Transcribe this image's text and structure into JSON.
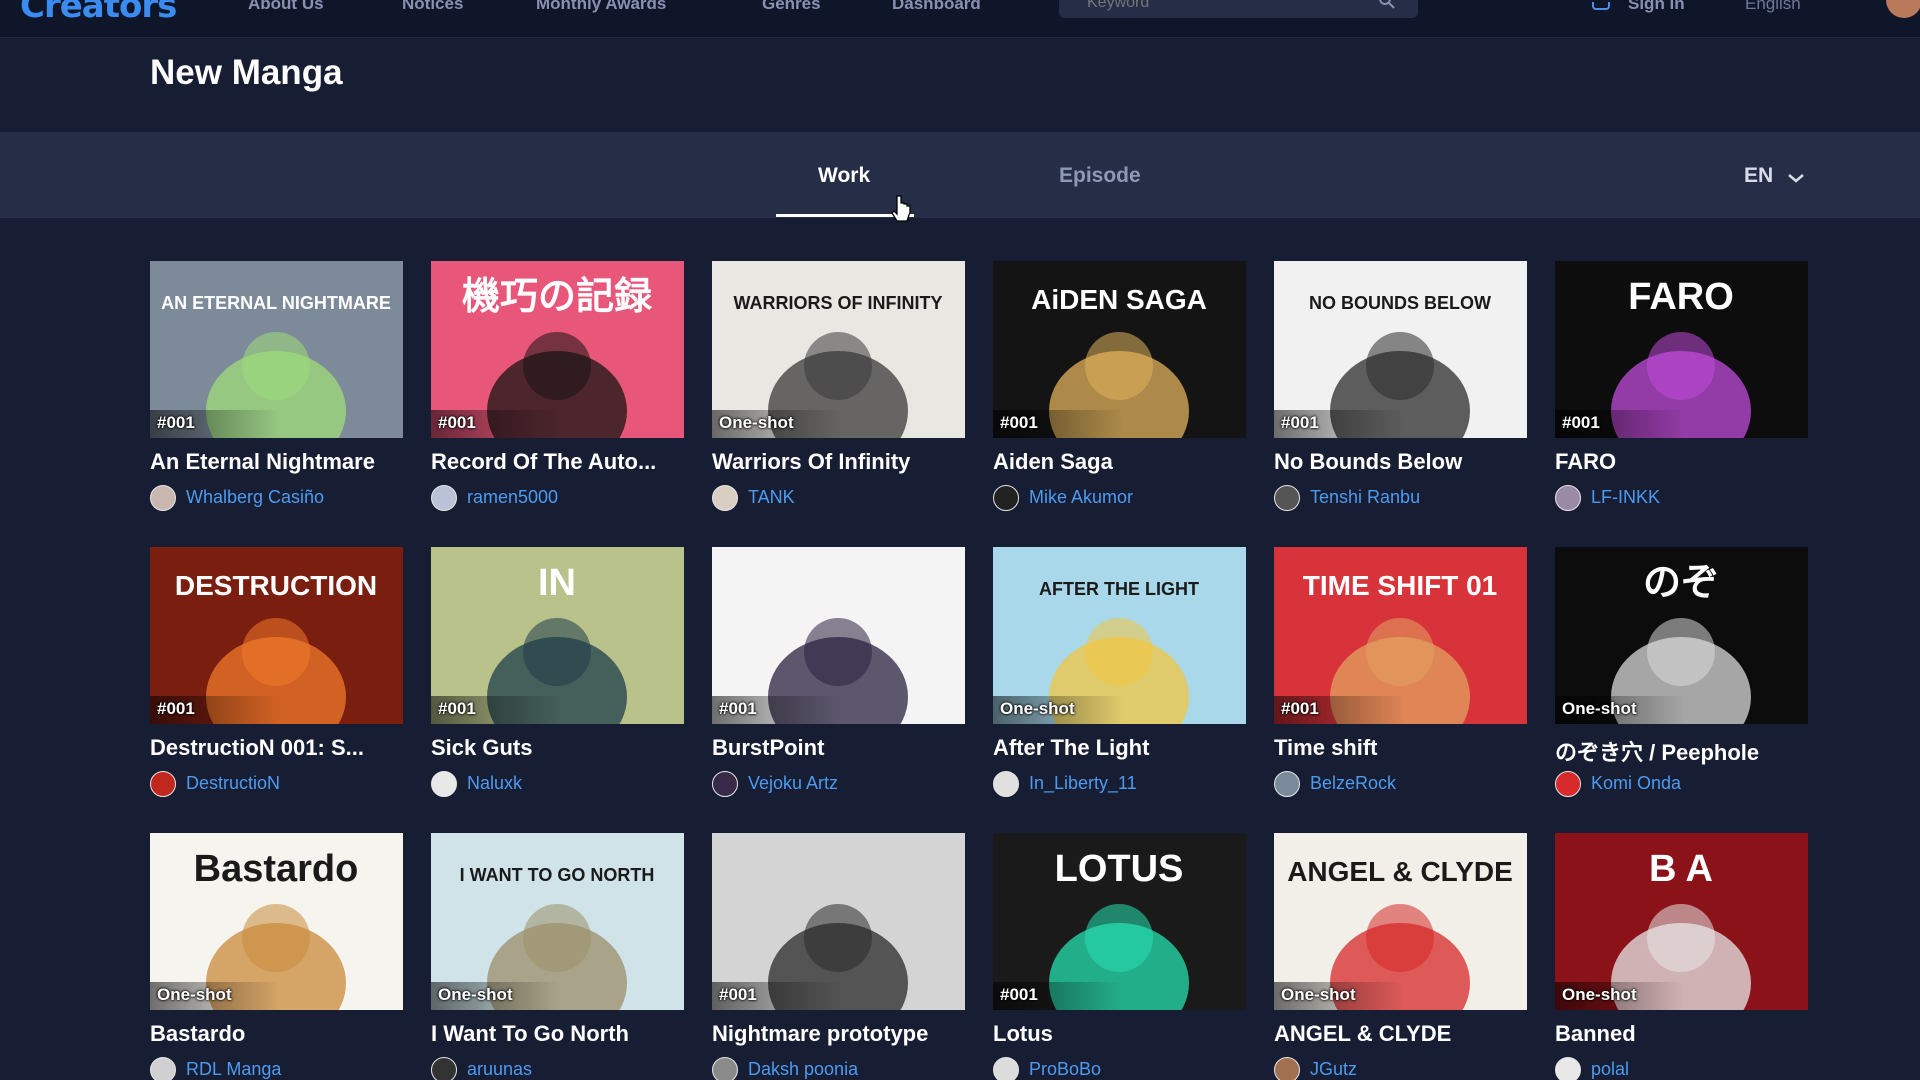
{
  "topbar": {
    "logo": "Creators",
    "nav": [
      "About Us",
      "Notices",
      "Monthly Awards",
      "Genres",
      "Dashboard"
    ],
    "search_placeholder": "Keyword",
    "signin": "Sign in",
    "language": "English"
  },
  "header": {
    "title": "New Manga"
  },
  "tabs": [
    {
      "label": "Work",
      "active": true
    },
    {
      "label": "Episode",
      "active": false
    }
  ],
  "language_select": "EN",
  "cards": [
    {
      "title": "An Eternal Nightmare",
      "author": "Whalberg Casiño",
      "badge": "#001",
      "cover_text": "AN ETERNAL NIGHTMARE",
      "bg": "#7d8a9a",
      "accent": "#9fdc7a",
      "avatar": "#c9b8b0"
    },
    {
      "title": "Record Of The Auto...",
      "author": "ramen5000",
      "badge": "#001",
      "cover_text": "機巧の記録",
      "bg": "#e8577a",
      "accent": "#1a1414",
      "avatar": "#b9c2d6"
    },
    {
      "title": "Warriors Of Infinity",
      "author": "TANK",
      "badge": "One-shot",
      "cover_text": "WARRIORS OF INFINITY",
      "bg": "#e9e7e2",
      "accent": "#3a3a3a",
      "avatar": "#d8cfc2"
    },
    {
      "title": "Aiden Saga",
      "author": "Mike Akumor",
      "badge": "#001",
      "cover_text": "AiDEN SAGA",
      "bg": "#141414",
      "accent": "#e0b25b",
      "avatar": "#222222"
    },
    {
      "title": "No Bounds Below",
      "author": "Tenshi Ranbu",
      "badge": "#001",
      "cover_text": "NO BOUNDS BELOW",
      "bg": "#f1f1f1",
      "accent": "#2b2b2b",
      "avatar": "#555555"
    },
    {
      "title": "FARO",
      "author": "LF-INKK",
      "badge": "#001",
      "cover_text": "FARO",
      "bg": "#0d0d0d",
      "accent": "#c04bd9",
      "avatar": "#9a8aa6"
    },
    {
      "title": "DestructioN 001: S...",
      "author": "DestructioN",
      "badge": "#001",
      "cover_text": "DESTRUCTION",
      "bg": "#7a1e10",
      "accent": "#f07a2a",
      "avatar": "#c0281e"
    },
    {
      "title": "Sick Guts",
      "author": "Naluxk",
      "badge": "#001",
      "cover_text": "IN",
      "bg": "#b9c28a",
      "accent": "#1f3d4a",
      "avatar": "#e8e8e8"
    },
    {
      "title": "BurstPoint",
      "author": "Vejoku Artz",
      "badge": "#001",
      "cover_text": "",
      "bg": "#f4f4f4",
      "accent": "#2a2340",
      "avatar": "#3a2a4a"
    },
    {
      "title": "After The Light",
      "author": "In_Liberty_11",
      "badge": "One-shot",
      "cover_text": "AFTER THE LIGHT",
      "bg": "#a8d8ea",
      "accent": "#f3c742",
      "avatar": "#e0e0e0"
    },
    {
      "title": "Time shift",
      "author": "BelzeRock",
      "badge": "#001",
      "cover_text": "TIME SHIFT 01",
      "bg": "#d8333a",
      "accent": "#e2a260",
      "avatar": "#7a8a9a"
    },
    {
      "title": "のぞき穴 / Peephole",
      "author": "Komi Onda",
      "badge": "One-shot",
      "cover_text": "のぞ",
      "bg": "#0c0c0c",
      "accent": "#d9d9d9",
      "avatar": "#d82a2a"
    },
    {
      "title": "Bastardo",
      "author": "RDL Manga",
      "badge": "One-shot",
      "cover_text": "Bastardo",
      "bg": "#f5f4ee",
      "accent": "#c98a3a",
      "avatar": "#d0d0d0"
    },
    {
      "title": "I Want To Go North",
      "author": "aruunas",
      "badge": "One-shot",
      "cover_text": "I WANT TO GO NORTH",
      "bg": "#cfe3e8",
      "accent": "#9c8f6a",
      "avatar": "#333333"
    },
    {
      "title": "Nightmare prototype",
      "author": "Daksh poonia",
      "badge": "#001",
      "cover_text": "",
      "bg": "#d4d4d4",
      "accent": "#2a2a2a",
      "avatar": "#8a8a8a"
    },
    {
      "title": "Lotus",
      "author": "ProBoBo",
      "badge": "#001",
      "cover_text": "LOTUS",
      "bg": "#1a1a1a",
      "accent": "#27e0b0",
      "avatar": "#dcdcdc"
    },
    {
      "title": "ANGEL & CLYDE",
      "author": "JGutz",
      "badge": "One-shot",
      "cover_text": "ANGEL & CLYDE",
      "bg": "#f2efe8",
      "accent": "#d62828",
      "avatar": "#a07050"
    },
    {
      "title": "Banned",
      "author": "polal",
      "badge": "One-shot",
      "cover_text": "B A",
      "bg": "#8a1218",
      "accent": "#e8e8e8",
      "avatar": "#e8e8e8"
    }
  ],
  "colors": {
    "background": "#171d33",
    "tabbar": "#252d47",
    "author_link": "#4d9bf0"
  }
}
